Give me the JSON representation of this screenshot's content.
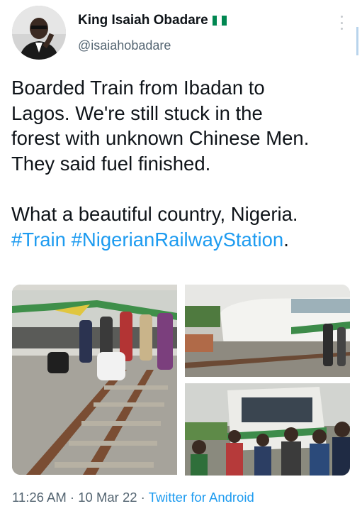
{
  "author": {
    "display_name": "King Isaiah Obadare",
    "flag": "nigeria-flag",
    "handle": "@isaiahobadare",
    "avatar_icon": "profile-photo"
  },
  "tweet": {
    "paragraph_1": "Boarded Train from Ibadan to\nLagos. We're still stuck in the\nforest with unknown Chinese Men.\nThey said fuel finished.",
    "paragraph_2_text": "What a beautiful country, Nigeria.",
    "hashtag_1": "#Train",
    "hashtag_2": "#NigerianRailwayStation",
    "trailing_punct": "."
  },
  "media": [
    {
      "description_icon": "photo-people-on-railway-tracks"
    },
    {
      "description_icon": "photo-derailed-train-car"
    },
    {
      "description_icon": "photo-crowd-by-train-front"
    }
  ],
  "meta": {
    "time": "11:26 AM",
    "separator": " · ",
    "date": "10 Mar 22",
    "source": "Twitter for Android"
  },
  "colors": {
    "text": "#0f1419",
    "secondary": "#536471",
    "link": "#1d9bf0",
    "flag_green": "#008751"
  }
}
